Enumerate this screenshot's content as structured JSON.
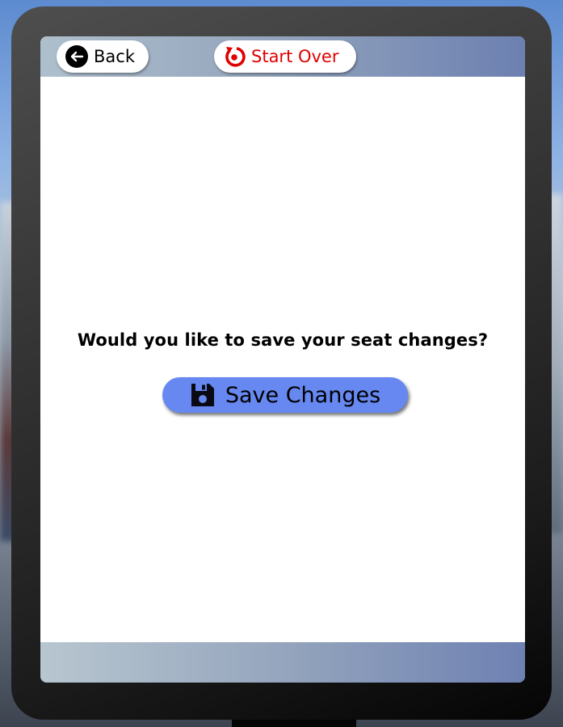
{
  "header": {
    "back_label": "Back",
    "start_over_label": "Start Over"
  },
  "main": {
    "question": "Would you like to save your seat changes?",
    "save_label": "Save Changes"
  },
  "icons": {
    "back": "arrow-left-circle-icon",
    "start_over": "restart-icon",
    "save": "floppy-disk-icon"
  },
  "colors": {
    "start_over_text": "#e00000",
    "save_button_bg": "#6688f0"
  }
}
